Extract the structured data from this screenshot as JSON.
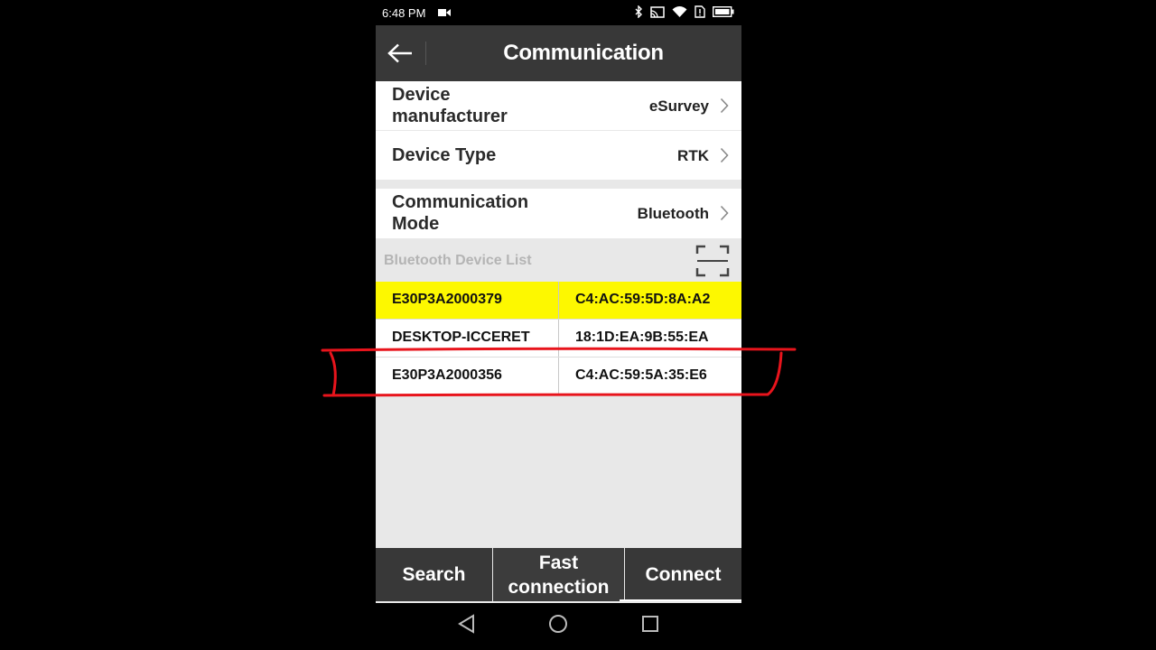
{
  "status_bar": {
    "time": "6:48 PM",
    "icons": [
      "video-icon",
      "bluetooth-icon",
      "cast-icon",
      "wifi-icon",
      "sim-alert-icon",
      "battery-icon"
    ]
  },
  "header": {
    "title": "Communication",
    "back_icon": "arrow-left-icon"
  },
  "settings": [
    {
      "label": "Device manufacturer",
      "value": "eSurvey"
    },
    {
      "label": "Device Type",
      "value": "RTK"
    },
    {
      "label": "Communication Mode",
      "value": "Bluetooth"
    }
  ],
  "device_list": {
    "title": "Bluetooth Device List",
    "scan_icon": "scan-frame-icon",
    "devices": [
      {
        "name": "E30P3A2000379",
        "mac": "C4:AC:59:5D:8A:A2",
        "selected": true
      },
      {
        "name": "DESKTOP-ICCERET",
        "mac": "18:1D:EA:9B:55:EA",
        "selected": false
      },
      {
        "name": "E30P3A2000356",
        "mac": "C4:AC:59:5A:35:E6",
        "selected": false
      }
    ]
  },
  "bottom_bar": {
    "search_label": "Search",
    "fast_connection_label": "Fast connection",
    "connect_label": "Connect"
  },
  "nav_bar": {
    "icons": [
      "back-triangle-icon",
      "home-circle-icon",
      "recents-square-icon"
    ]
  },
  "colors": {
    "header_bg": "#383838",
    "selected_row": "#fdf800",
    "annotation": "#e8141c"
  }
}
